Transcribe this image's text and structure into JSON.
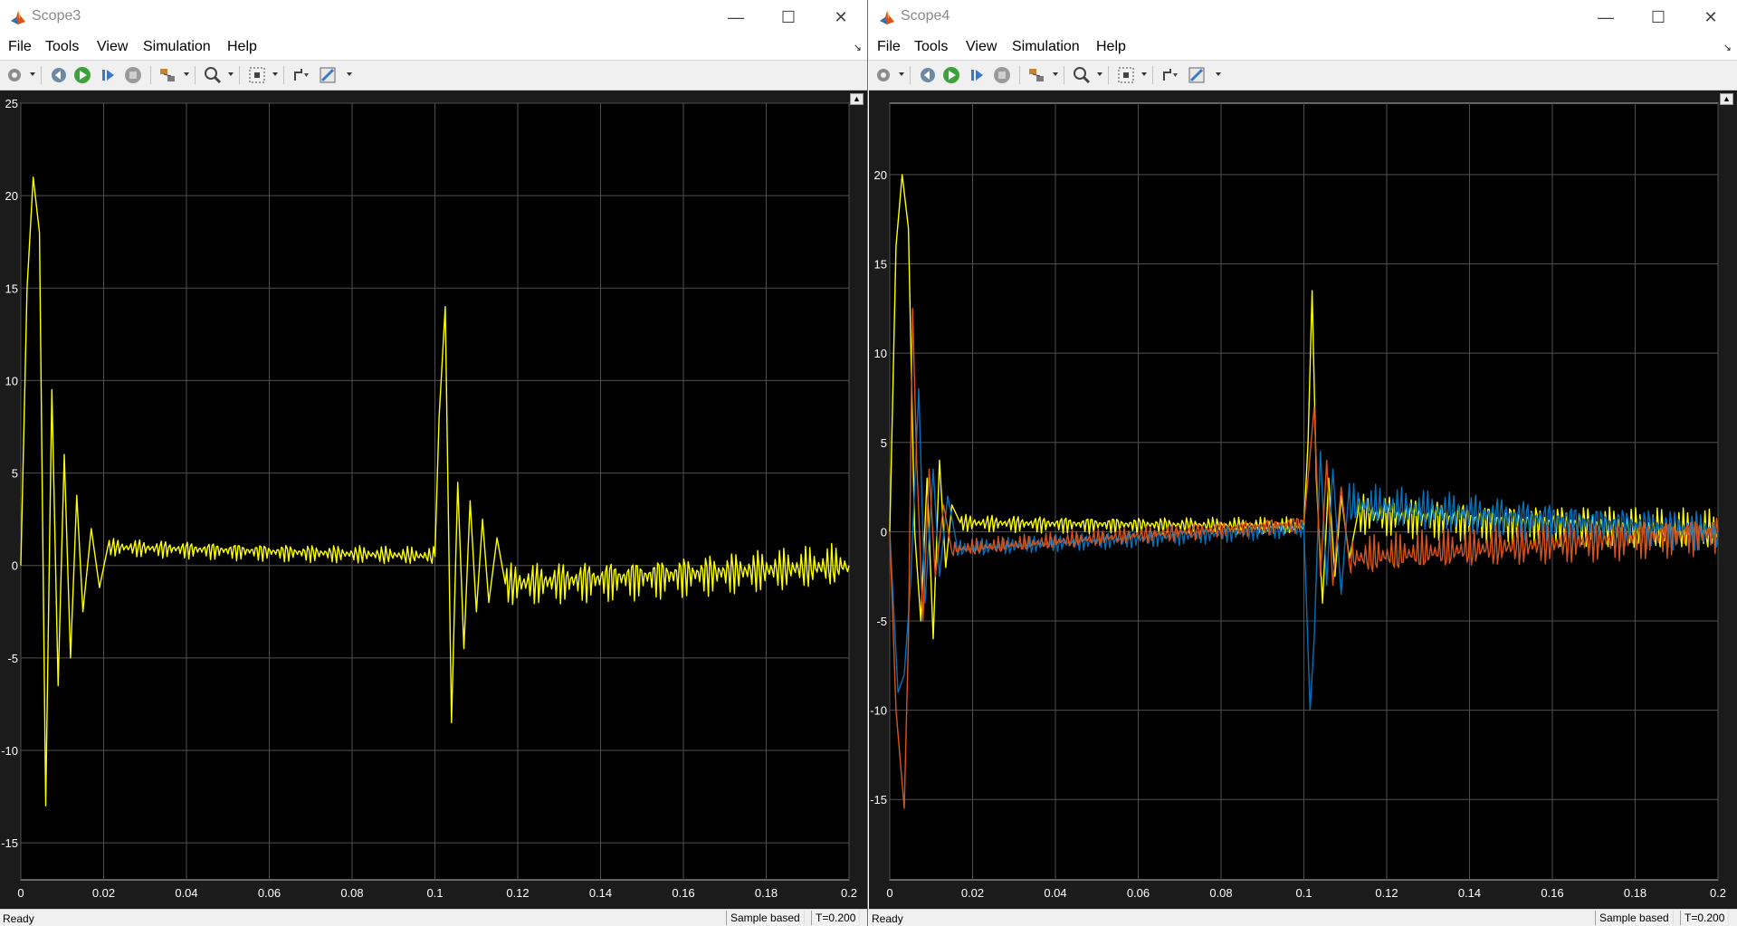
{
  "windows": [
    {
      "title": "Scope3",
      "menu": [
        "File",
        "Tools",
        "View",
        "Simulation",
        "Help"
      ],
      "status": {
        "ready": "Ready",
        "mode": "Sample based",
        "time": "T=0.200"
      },
      "chart_data": {
        "type": "line",
        "xlim": [
          0,
          0.2
        ],
        "ylim": [
          -17,
          25
        ],
        "xticks": [
          "0",
          "0.02",
          "0.04",
          "0.06",
          "0.08",
          "0.1",
          "0.12",
          "0.14",
          "0.16",
          "0.18",
          "0.2"
        ],
        "yticks": [
          "-15",
          "-10",
          "-5",
          "0",
          "5",
          "10",
          "15",
          "20",
          "25"
        ],
        "grid": true,
        "series": [
          {
            "color": "#ffff00",
            "x": [
              0,
              0.0015,
              0.003,
              0.0045,
              0.006,
              0.0075,
              0.009,
              0.0105,
              0.012,
              0.0135,
              0.015,
              0.017,
              0.019,
              0.021,
              0.1,
              0.101,
              0.1025,
              0.104,
              0.1055,
              0.107,
              0.1085,
              0.11,
              0.1115,
              0.113,
              0.115,
              0.117,
              0.2
            ],
            "y": [
              0,
              15,
              21,
              18,
              -13,
              9.5,
              -6.5,
              6,
              -5,
              3.8,
              -2.5,
              2,
              -1.2,
              1,
              0.5,
              8,
              14,
              -8.5,
              4.5,
              -4.5,
              3.5,
              -2.5,
              2.5,
              -2,
              1.5,
              -1,
              0
            ]
          }
        ]
      }
    },
    {
      "title": "Scope4",
      "menu": [
        "File",
        "Tools",
        "View",
        "Simulation",
        "Help"
      ],
      "status": {
        "ready": "Ready",
        "mode": "Sample based",
        "time": "T=0.200"
      },
      "chart_data": {
        "type": "line",
        "xlim": [
          0,
          0.2
        ],
        "ylim": [
          -19.5,
          24
        ],
        "xticks": [
          "0",
          "0.02",
          "0.04",
          "0.06",
          "0.08",
          "0.1",
          "0.12",
          "0.14",
          "0.16",
          "0.18",
          "0.2"
        ],
        "yticks": [
          "-15",
          "-10",
          "-5",
          "0",
          "5",
          "10",
          "15",
          "20"
        ],
        "grid": true,
        "series": [
          {
            "color": "#ffff00",
            "x": [
              0,
              0.0015,
              0.003,
              0.0045,
              0.006,
              0.0075,
              0.009,
              0.0105,
              0.012,
              0.0135,
              0.015,
              0.017,
              0.1,
              0.101,
              0.102,
              0.103,
              0.1045,
              0.106,
              0.1075,
              0.109,
              0.111,
              0.113,
              0.2
            ],
            "y": [
              0,
              16,
              20,
              17,
              0,
              -5,
              3,
              -6,
              4,
              -2,
              1.5,
              0.5,
              0.3,
              5,
              13.5,
              3,
              -4,
              3,
              -2.5,
              2,
              -1.5,
              1,
              0
            ]
          },
          {
            "color": "#0072bd",
            "x": [
              0,
              0.002,
              0.0035,
              0.005,
              0.007,
              0.0085,
              0.0105,
              0.012,
              0.014,
              0.016,
              0.1,
              0.1015,
              0.1025,
              0.104,
              0.1055,
              0.107,
              0.109,
              0.111,
              0.2
            ],
            "y": [
              0,
              -9,
              -8,
              -3,
              8,
              -4,
              3.5,
              -2.5,
              2,
              -1,
              0.2,
              -10,
              -6,
              4.5,
              -3,
              3.5,
              -3.5,
              1.5,
              0
            ]
          },
          {
            "color": "#d95319",
            "x": [
              0,
              0.0015,
              0.0035,
              0.0045,
              0.0055,
              0.0065,
              0.008,
              0.0095,
              0.011,
              0.013,
              0.015,
              0.1,
              0.101,
              0.1025,
              0.104,
              0.1055,
              0.107,
              0.109,
              0.111,
              0.2
            ],
            "y": [
              0,
              -10,
              -15.5,
              -6,
              12.5,
              4,
              -5,
              3.5,
              -2.5,
              1.5,
              -1,
              0.5,
              3,
              7,
              -2.5,
              4,
              -3,
              2.5,
              -1.5,
              0
            ]
          }
        ]
      }
    }
  ]
}
